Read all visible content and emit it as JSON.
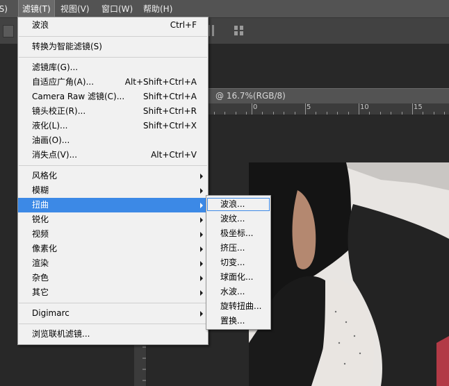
{
  "menubar": {
    "items": [
      {
        "label": "(S)"
      },
      {
        "label": "滤镜(T)"
      },
      {
        "label": "视图(V)"
      },
      {
        "label": "窗口(W)"
      },
      {
        "label": "帮助(H)"
      }
    ]
  },
  "document": {
    "tab_title": "@ 16.7%(RGB/8)"
  },
  "ruler": {
    "labels": [
      "0",
      "5",
      "10",
      "15"
    ]
  },
  "filter_menu": {
    "items": [
      {
        "label": "波浪",
        "shortcut": "Ctrl+F"
      },
      {
        "label": "转换为智能滤镜(S)",
        "shortcut": ""
      },
      {
        "label": "滤镜库(G)...",
        "shortcut": ""
      },
      {
        "label": "自适应广角(A)...",
        "shortcut": "Alt+Shift+Ctrl+A"
      },
      {
        "label": "Camera Raw 滤镜(C)...",
        "shortcut": "Shift+Ctrl+A"
      },
      {
        "label": "镜头校正(R)...",
        "shortcut": "Shift+Ctrl+R"
      },
      {
        "label": "液化(L)...",
        "shortcut": "Shift+Ctrl+X"
      },
      {
        "label": "油画(O)...",
        "shortcut": ""
      },
      {
        "label": "消失点(V)...",
        "shortcut": "Alt+Ctrl+V"
      },
      {
        "label": "风格化",
        "shortcut": ""
      },
      {
        "label": "模糊",
        "shortcut": ""
      },
      {
        "label": "扭曲",
        "shortcut": ""
      },
      {
        "label": "锐化",
        "shortcut": ""
      },
      {
        "label": "视频",
        "shortcut": ""
      },
      {
        "label": "像素化",
        "shortcut": ""
      },
      {
        "label": "渲染",
        "shortcut": ""
      },
      {
        "label": "杂色",
        "shortcut": ""
      },
      {
        "label": "其它",
        "shortcut": ""
      },
      {
        "label": "Digimarc",
        "shortcut": ""
      },
      {
        "label": "浏览联机滤镜...",
        "shortcut": ""
      }
    ]
  },
  "distort_submenu": {
    "items": [
      {
        "label": "波浪..."
      },
      {
        "label": "波纹..."
      },
      {
        "label": "极坐标..."
      },
      {
        "label": "挤压..."
      },
      {
        "label": "切变..."
      },
      {
        "label": "球面化..."
      },
      {
        "label": "水波..."
      },
      {
        "label": "旋转扭曲..."
      },
      {
        "label": "置换..."
      }
    ]
  },
  "colors": {
    "menu_highlight": "#3c89e6",
    "menu_bg": "#f1f1f1",
    "app_bg": "#535353"
  }
}
